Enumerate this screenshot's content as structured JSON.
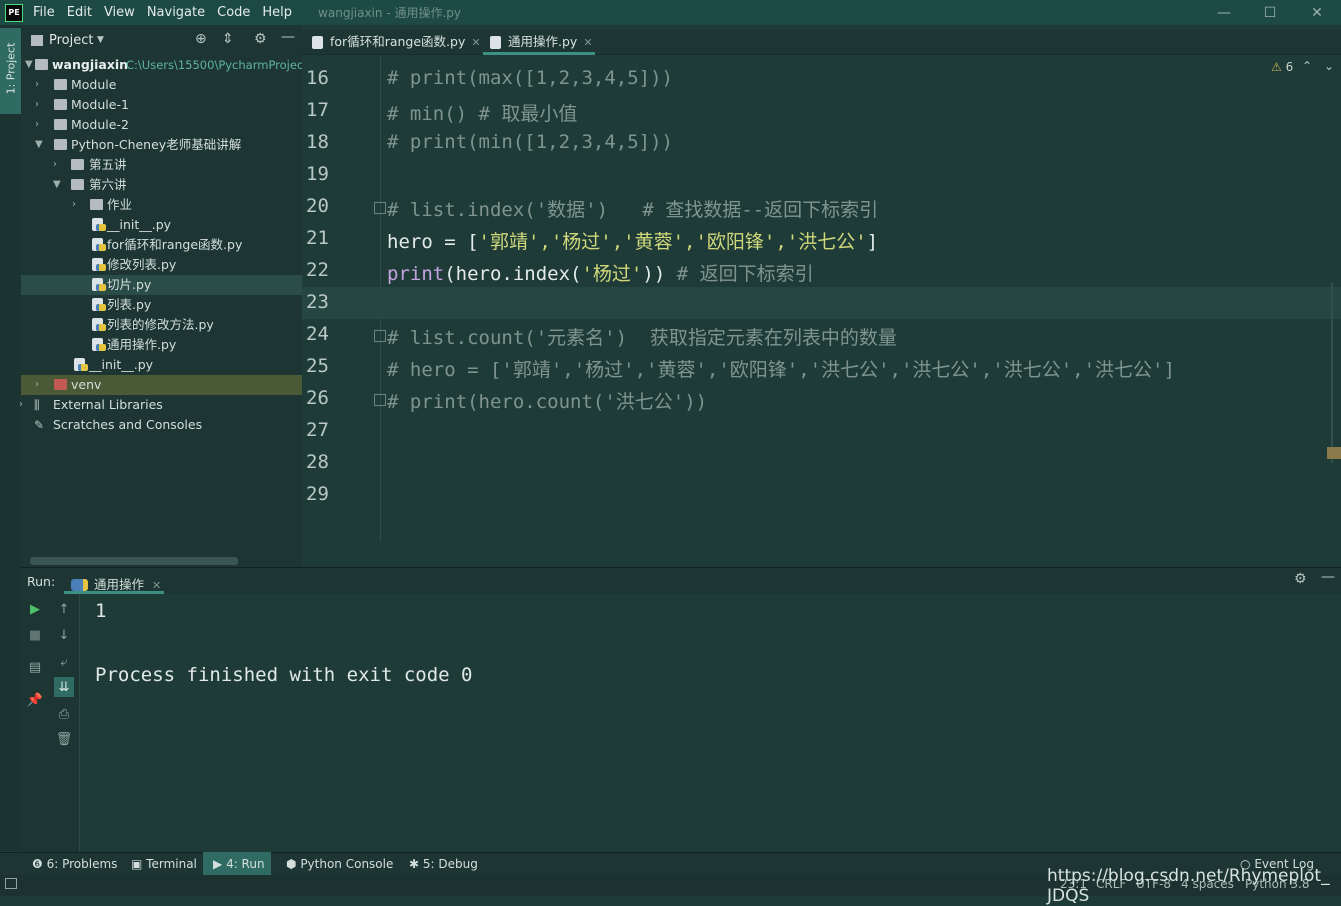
{
  "menubar": {
    "logo": "PE",
    "items": [
      "File",
      "Edit",
      "View",
      "Navigate",
      "Code",
      "Help"
    ],
    "window_title": "wangjiaxin - 通用操作.py",
    "controls": [
      "—",
      "☐",
      "✕"
    ]
  },
  "left_strip": {
    "project_label": "1: Project"
  },
  "project": {
    "title": "Project",
    "root_name": "wangjiaxin",
    "root_path": "C:\\Users\\15500\\PycharmProjec",
    "items": [
      {
        "label": "Module"
      },
      {
        "label": "Module-1"
      },
      {
        "label": "Module-2"
      },
      {
        "label": "Python-Cheney老师基础讲解"
      },
      {
        "label": "第五讲"
      },
      {
        "label": "第六讲"
      },
      {
        "label": "作业"
      },
      {
        "label": "__init__.py"
      },
      {
        "label": "for循环和range函数.py"
      },
      {
        "label": "修改列表.py"
      },
      {
        "label": "切片.py"
      },
      {
        "label": "列表.py"
      },
      {
        "label": "列表的修改方法.py"
      },
      {
        "label": "通用操作.py"
      },
      {
        "label": "__init__.py"
      },
      {
        "label": "venv"
      },
      {
        "label": "External Libraries"
      },
      {
        "label": "Scratches and Consoles"
      }
    ]
  },
  "editor": {
    "tabs": [
      {
        "label": "for循环和range函数.py"
      },
      {
        "label": "通用操作.py"
      }
    ],
    "warning_count": "6",
    "line_numbers": [
      "16",
      "17",
      "18",
      "19",
      "20",
      "21",
      "22",
      "23",
      "24",
      "25",
      "26",
      "27",
      "28",
      "29"
    ],
    "lines": {
      "l16": "# print(max([1,2,3,4,5]))",
      "l17": "# min() # 取最小值",
      "l18": "# print(min([1,2,3,4,5]))",
      "l20": "# list.index('数据')   # 查找数据--返回下标索引",
      "l21_a": "hero = [",
      "l21_b": "'郭靖','杨过','黄蓉','欧阳锋','洪七公'",
      "l21_c": "]",
      "l22_a": "print",
      "l22_b": "(hero.index(",
      "l22_c": "'杨过'",
      "l22_d": "))",
      "l22_e": " # 返回下标索引",
      "l24": "# list.count('元素名')  获取指定元素在列表中的数量",
      "l25": "# hero = ['郭靖','杨过','黄蓉','欧阳锋','洪七公','洪七公','洪七公','洪七公']",
      "l26": "# print(hero.count('洪七公'))"
    }
  },
  "run": {
    "label": "Run:",
    "tab": "通用操作",
    "output": [
      "1",
      "",
      "Process finished with exit code 0"
    ]
  },
  "bottom_tools": {
    "problems": "6: Problems",
    "terminal": "Terminal",
    "run": "4: Run",
    "python_console": "Python Console",
    "debug": "5: Debug",
    "event_log": "Event Log"
  },
  "status": {
    "position": "23:1",
    "line_sep": "CRLF",
    "encoding": "UTF-8",
    "indent": "4 spaces",
    "interpreter": "Python 3.8"
  },
  "watermark": "https://blog.csdn.net/Rhymeplot_ JDQS"
}
